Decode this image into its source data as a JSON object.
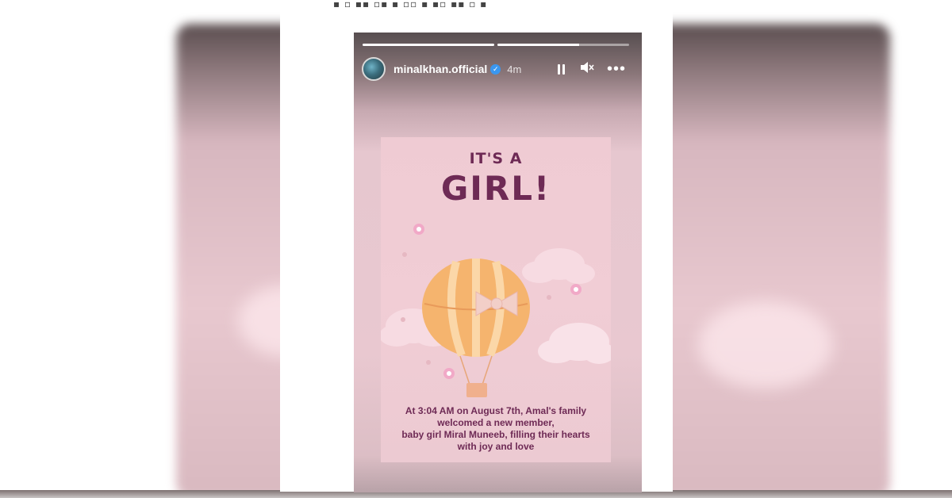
{
  "story": {
    "username": "minalkhan.official",
    "verified_icon": "verified-badge-icon",
    "time": "4m",
    "progress": [
      1.0,
      0.62
    ],
    "controls": {
      "pause_icon": "pause-icon",
      "mute_icon": "mute-icon",
      "more_icon": "more-icon"
    }
  },
  "invitation": {
    "line1": "IT'S A",
    "line2": "GIRL!",
    "message": [
      "At 3:04 AM on August 7th, Amal's family",
      "welcomed a new member,",
      "baby girl Miral Muneeb, filling their hearts",
      "with joy and love"
    ]
  },
  "colors": {
    "accent": "#6e2a55",
    "verified": "#3a97f0",
    "balloon_orange": "#f5b46e",
    "background_pink": "#efcbd3"
  }
}
